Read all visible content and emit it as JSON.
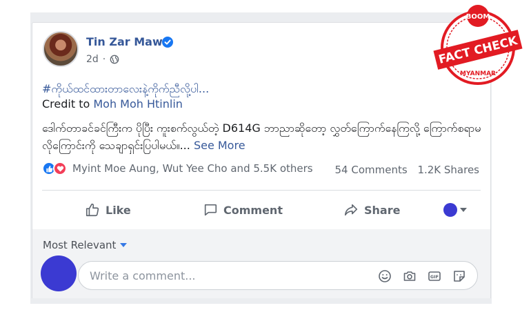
{
  "post": {
    "author": "Tin Zar Maw",
    "time": "2d",
    "hashtag": "#ကိုယ်ထင်ထားတာလေးနဲ့ကိုက်ညီလို့ပါ...",
    "credit_prefix": "Credit to",
    "credit_name": "Moh Moh Htinlin",
    "body": "ဒေါက်တာခင်ခင်ကြီးက ပိုပြီး ကူးစက်လွယ်တဲ့ D614G ဘာညာဆိုတော့ လွှတ်ကြောက်နေကြလို့ ကြောက်စရာမလိုကြောင်းကို သေချာရှင်းပြပါမယ်။...",
    "see_more": "See More"
  },
  "reactions": {
    "names": "Myint Moe Aung, Wut Yee Cho and 5.5K others",
    "comments": "54 Comments",
    "shares": "1.2K Shares"
  },
  "actions": {
    "like": "Like",
    "comment": "Comment",
    "share": "Share"
  },
  "comments_section": {
    "sort_label": "Most Relevant",
    "placeholder": "Write a comment..."
  },
  "stamp": {
    "top_text": "BOOM",
    "main_text": "FACT CHECK",
    "bottom_text": "MYANMAR"
  },
  "colors": {
    "link": "#365899",
    "accent": "#1877f2",
    "stamp_red": "#e21b23",
    "avatar_blue": "#3b3ad2"
  },
  "icons": [
    "verified-icon",
    "globe-icon",
    "like-icon",
    "comment-icon",
    "share-icon",
    "emoji-icon",
    "camera-icon",
    "gif-icon",
    "sticker-icon"
  ]
}
